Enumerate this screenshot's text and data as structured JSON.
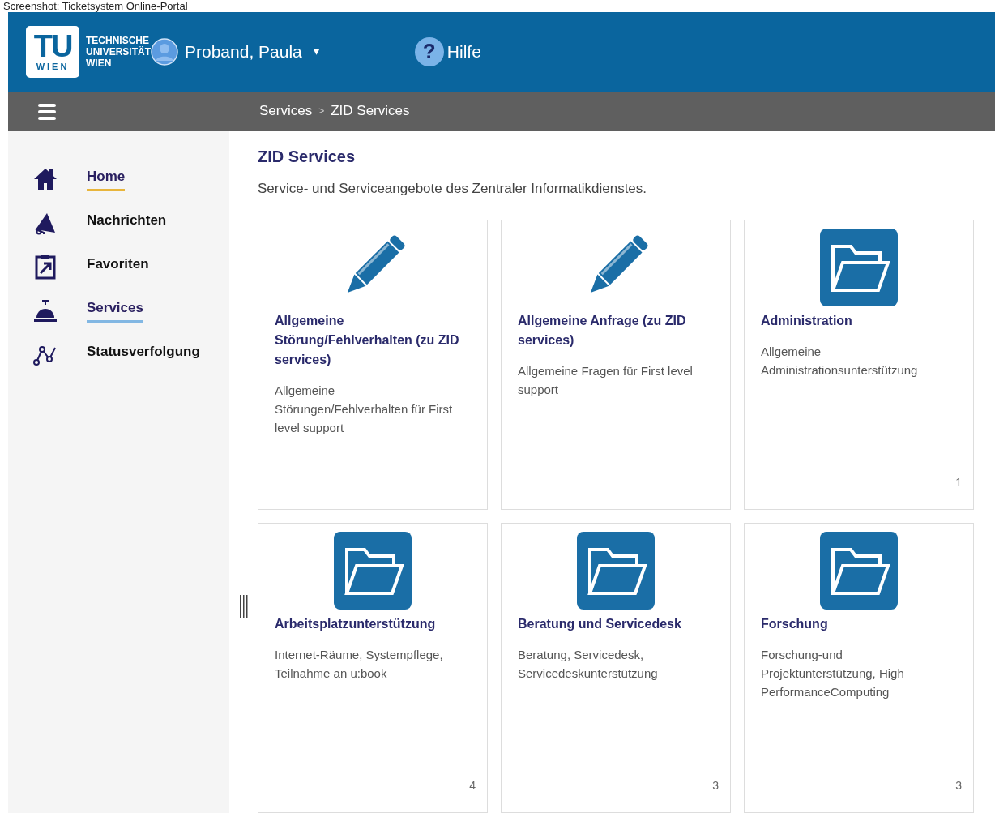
{
  "caption": "Screenshot: Ticketsystem Online-Portal",
  "header": {
    "logo_letters": "TU",
    "logo_sub": "WIEN",
    "university": [
      "TECHNISCHE",
      "UNIVERSITÄT",
      "WIEN"
    ],
    "user": "Proband, Paula",
    "caret": "▾",
    "help_symbol": "?",
    "help": "Hilfe"
  },
  "breadcrumb": [
    "Services",
    "ZID Services"
  ],
  "breadcrumb_separator": ">",
  "sidebar": {
    "items": [
      {
        "kind": "home",
        "label": "Home",
        "selected": false,
        "hovered": true
      },
      {
        "kind": "megaphone",
        "label": "Nachrichten",
        "selected": false,
        "hovered": false
      },
      {
        "kind": "clipboard",
        "label": "Favoriten",
        "selected": false,
        "hovered": false
      },
      {
        "kind": "bell",
        "label": "Services",
        "selected": true,
        "hovered": false
      },
      {
        "kind": "graph",
        "label": "Statusverfolgung",
        "selected": false,
        "hovered": false
      }
    ]
  },
  "page": {
    "title": "ZID Services",
    "subtitle": "Service- und Serviceangebote des Zentraler Informatikdienstes."
  },
  "cards": [
    {
      "kind": "pencil",
      "title": "Allgemeine Störung/Fehlverhalten (zu ZID services)",
      "description": "Allgemeine Störungen/Fehlverhalten für First level support"
    },
    {
      "kind": "pencil",
      "title": "Allgemeine Anfrage (zu ZID services)",
      "description": "Allgemeine Fragen für First level support"
    },
    {
      "kind": "folder",
      "title": "Administration",
      "description": "Allgemeine Administrationsunterstützung",
      "count": "1"
    },
    {
      "kind": "folder",
      "title": "Arbeitsplatzunterstützung",
      "description": "Internet-Räume, Systempflege, Teilnahme an u:book",
      "count": "4"
    },
    {
      "kind": "folder",
      "title": "Beratung und Servicedesk",
      "description": "Beratung, Servicedesk, Servicedeskunterstützung",
      "count": "3"
    },
    {
      "kind": "folder",
      "title": "Forschung",
      "description": "Forschung-und Projektunterstützung, High PerformanceComputing",
      "count": "3"
    }
  ]
}
